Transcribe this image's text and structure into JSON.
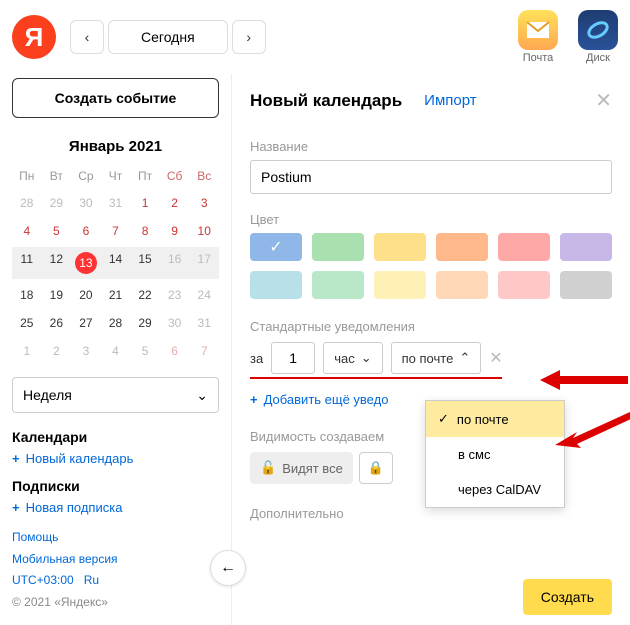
{
  "top": {
    "today": "Сегодня",
    "mail": "Почта",
    "disk": "Диск"
  },
  "sidebar": {
    "create_event": "Создать событие",
    "month_title": "Январь 2021",
    "weekdays": [
      "Пн",
      "Вт",
      "Ср",
      "Чт",
      "Пт",
      "Сб",
      "Вс"
    ],
    "weeks": [
      [
        {
          "n": 28,
          "t": "out"
        },
        {
          "n": 29,
          "t": "out"
        },
        {
          "n": 30,
          "t": "out"
        },
        {
          "n": 31,
          "t": "out"
        },
        {
          "n": 1,
          "t": "we"
        },
        {
          "n": 2,
          "t": "we"
        },
        {
          "n": 3,
          "t": "we"
        }
      ],
      [
        {
          "n": 4,
          "t": "we"
        },
        {
          "n": 5,
          "t": "we"
        },
        {
          "n": 6,
          "t": "we"
        },
        {
          "n": 7,
          "t": "we"
        },
        {
          "n": 8,
          "t": "we"
        },
        {
          "n": 9,
          "t": "we"
        },
        {
          "n": 10,
          "t": "we"
        }
      ],
      [
        {
          "n": 11,
          "t": ""
        },
        {
          "n": 12,
          "t": ""
        },
        {
          "n": 13,
          "t": "today"
        },
        {
          "n": 14,
          "t": ""
        },
        {
          "n": 15,
          "t": ""
        },
        {
          "n": 16,
          "t": "out"
        },
        {
          "n": 17,
          "t": "out"
        }
      ],
      [
        {
          "n": 18,
          "t": ""
        },
        {
          "n": 19,
          "t": ""
        },
        {
          "n": 20,
          "t": ""
        },
        {
          "n": 21,
          "t": ""
        },
        {
          "n": 22,
          "t": ""
        },
        {
          "n": 23,
          "t": "out"
        },
        {
          "n": 24,
          "t": "out"
        }
      ],
      [
        {
          "n": 25,
          "t": ""
        },
        {
          "n": 26,
          "t": ""
        },
        {
          "n": 27,
          "t": ""
        },
        {
          "n": 28,
          "t": ""
        },
        {
          "n": 29,
          "t": ""
        },
        {
          "n": 30,
          "t": "out"
        },
        {
          "n": 31,
          "t": "out"
        }
      ],
      [
        {
          "n": 1,
          "t": "out"
        },
        {
          "n": 2,
          "t": "out"
        },
        {
          "n": 3,
          "t": "out"
        },
        {
          "n": 4,
          "t": "out"
        },
        {
          "n": 5,
          "t": "out"
        },
        {
          "n": 6,
          "t": "outw"
        },
        {
          "n": 7,
          "t": "outw"
        }
      ]
    ],
    "view": "Неделя",
    "calendars_h": "Календари",
    "new_calendar": "Новый календарь",
    "subs_h": "Подписки",
    "new_sub": "Новая подписка",
    "help": "Помощь",
    "mobile": "Мобильная версия",
    "tz": "UTC+03:00",
    "lang": "Ru",
    "copy": "© 2021 «Яндекс»"
  },
  "panel": {
    "title": "Новый календарь",
    "import": "Импорт",
    "name_label": "Название",
    "name_value": "Postium",
    "color_label": "Цвет",
    "colors_row1": [
      "#8fb7e8",
      "#a8e0b0",
      "#ffe08a",
      "#ffb88a",
      "#ffa8a8",
      "#c8b8e8"
    ],
    "colors_row2": [
      "#b8e0e8",
      "#b8e8c8",
      "#fff0b8",
      "#ffd8b8",
      "#ffc8c8",
      "#d0d0d0"
    ],
    "notif_label": "Стандартные уведомления",
    "notif_za": "за",
    "notif_value": "1",
    "notif_unit": "час",
    "notif_method": "по почте",
    "add_more": "Добавить ещё уведо",
    "vis_label": "Видимость создаваем",
    "vis_all": "Видят все",
    "extra_label": "Дополнительно",
    "create": "Создать"
  },
  "dropdown": {
    "opt1": "по почте",
    "opt2": "в смс",
    "opt3": "через CalDAV"
  }
}
